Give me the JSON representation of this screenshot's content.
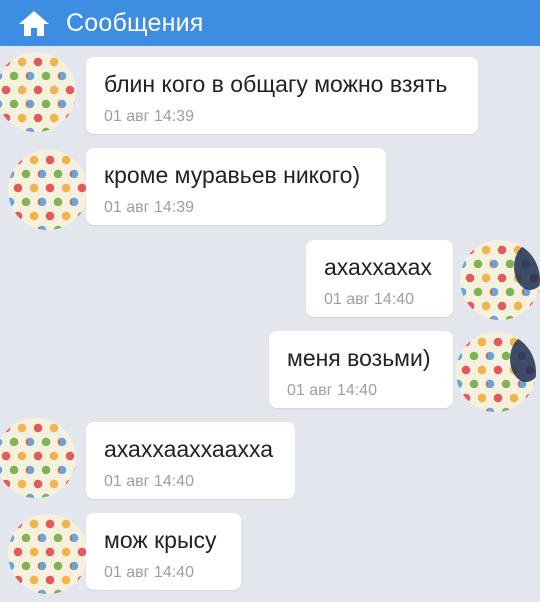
{
  "header": {
    "title": "Сообщения",
    "icon": "home-icon"
  },
  "messages": [
    {
      "text": "блин кого в общагу можно взять",
      "time": "01 авг 14:39",
      "side": "in"
    },
    {
      "text": "кроме муравьев никого)",
      "time": "01 авг 14:39",
      "side": "in"
    },
    {
      "text": "ахаххахах",
      "time": "01 авг 14:40",
      "side": "out"
    },
    {
      "text": "меня возьми)",
      "time": "01 авг 14:40",
      "side": "out"
    },
    {
      "text": "ахаххааххаахха",
      "time": "01 авг 14:40",
      "side": "in"
    },
    {
      "text": "мож крысу",
      "time": "01 авг 14:40",
      "side": "in"
    }
  ],
  "colors": {
    "accent": "#3d8ee3",
    "background": "#e3e7ed",
    "bubble": "#ffffff",
    "time": "#9a9ea6"
  }
}
